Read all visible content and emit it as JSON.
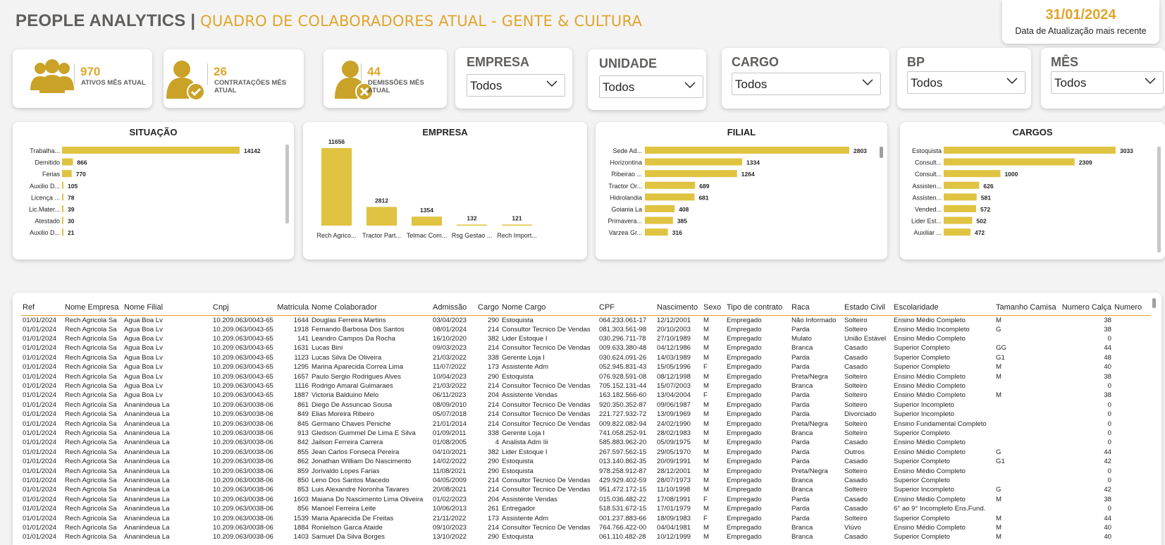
{
  "header": {
    "title_main": "PEOPLE ANALYTICS",
    "title_sep": "|",
    "title_sub": "QUADRO DE COLABORADORES ATUAL - GENTE & CULTURA"
  },
  "update": {
    "date": "31/01/2024",
    "label": "Data de Atualização mais recente"
  },
  "kpis": [
    {
      "value": "970",
      "label": "ATIVOS MÊS ATUAL",
      "icon": "group-icon"
    },
    {
      "value": "26",
      "label": "CONTRATAÇÕES MÊS ATUAL",
      "icon": "user-check-icon"
    },
    {
      "value": "44",
      "label": "DEMISSÕES MÊS ATUAL",
      "icon": "user-remove-icon"
    }
  ],
  "slicers": [
    {
      "title": "EMPRESA",
      "value": "Todos"
    },
    {
      "title": "UNIDADE",
      "value": "Todos"
    },
    {
      "title": "CARGO",
      "value": "Todos"
    },
    {
      "title": "BP",
      "value": "Todos"
    },
    {
      "title": "MÊS",
      "value": "Todos"
    }
  ],
  "colors": {
    "accent": "#e0a52a",
    "bar": "#e0c341",
    "title_gray": "#605e5c"
  },
  "chart_data": [
    {
      "type": "bar",
      "orientation": "horizontal",
      "title": "SITUAÇÃO",
      "categories": [
        "Trabalha...",
        "Demitido",
        "Ferias",
        "Auxilio D...",
        "Licença ...",
        "Lic.Mater...",
        "Atestado",
        "Auxilio D..."
      ],
      "values": [
        14142,
        866,
        770,
        105,
        78,
        39,
        30,
        21
      ]
    },
    {
      "type": "bar",
      "orientation": "vertical",
      "title": "EMPRESA",
      "categories": [
        "Rech Agrico...",
        "Tractor Part...",
        "Telmac Com...",
        "Rsg Gestao ...",
        "Rech Import..."
      ],
      "values": [
        11656,
        2812,
        1354,
        132,
        121
      ]
    },
    {
      "type": "bar",
      "orientation": "horizontal",
      "title": "FILIAL",
      "categories": [
        "Sede Ad...",
        "Horizontina",
        "Ribeirao ...",
        "Tractor Or...",
        "Hidrolandia",
        "Goiania La",
        "Primavera...",
        "Varzea Gr..."
      ],
      "values": [
        2803,
        1334,
        1264,
        689,
        681,
        408,
        385,
        316
      ]
    },
    {
      "type": "bar",
      "orientation": "horizontal",
      "title": "CARGOS",
      "categories": [
        "Estoquista",
        "Consult...",
        "Consult...",
        "Assisten...",
        "Assisten...",
        "Vended...",
        "Lider Est...",
        "Auxiliar ..."
      ],
      "values": [
        3033,
        2309,
        1000,
        626,
        581,
        572,
        502,
        472
      ]
    }
  ],
  "table": {
    "columns": [
      "Ref",
      "Nome Empresa",
      "Nome Filial",
      "Cnpj",
      "Matricula",
      "Nome Colaborador",
      "Admissão",
      "Cargo",
      "Nome Cargo",
      "CPF",
      "Nascimento",
      "Sexo",
      "Tipo de contrato",
      "Raca",
      "Estado Civil",
      "Escolaridade",
      "Tamanho Camisa",
      "Numero Calça",
      "Numero"
    ],
    "rows": [
      [
        "01/01/2024",
        "Rech Agricola Sa",
        "Agua Boa Lv",
        "10.209.063/0043-65",
        "1644",
        "Douglas Ferreira Martins",
        "03/04/2023",
        "290",
        "Estoquista",
        "064.233.061-17",
        "12/12/2001",
        "M",
        "Empregado",
        "Não Informado",
        "Solteiro",
        "Ensino Médio Completo",
        "M",
        "38",
        ""
      ],
      [
        "01/01/2024",
        "Rech Agricola Sa",
        "Agua Boa Lv",
        "10.209.063/0043-65",
        "1918",
        "Fernando Barbosa Dos Santos",
        "08/01/2024",
        "214",
        "Consultor Tecnico De Vendas",
        "081.303.561-98",
        "20/10/2003",
        "M",
        "Empregado",
        "Parda",
        "Solteiro",
        "Ensino Médio Incompleto",
        "G",
        "38",
        ""
      ],
      [
        "01/01/2024",
        "Rech Agricola Sa",
        "Agua Boa Lv",
        "10.209.063/0043-65",
        "141",
        "Leandro Campos Da Rocha",
        "16/10/2020",
        "382",
        "Lider Estoque I",
        "030.296.711-78",
        "27/10/1989",
        "M",
        "Empregado",
        "Mulato",
        "União Estável",
        "Ensino Médio Completo",
        "",
        "0",
        ""
      ],
      [
        "01/01/2024",
        "Rech Agricola Sa",
        "Agua Boa Lv",
        "10.209.063/0043-65",
        "1631",
        "Lucas Bini",
        "09/03/2023",
        "214",
        "Consultor Tecnico De Vendas",
        "009.633.380-48",
        "04/12/1986",
        "M",
        "Empregado",
        "Branca",
        "Casado",
        "Superior Completo",
        "GG",
        "44",
        ""
      ],
      [
        "01/01/2024",
        "Rech Agricola Sa",
        "Agua Boa Lv",
        "10.209.063/0043-65",
        "1123",
        "Lucas Silva De Oliveira",
        "21/03/2022",
        "338",
        "Gerente Loja I",
        "030.624.091-26",
        "14/03/1989",
        "M",
        "Empregado",
        "Parda",
        "Casado",
        "Superior Completo",
        "G1",
        "48",
        ""
      ],
      [
        "01/01/2024",
        "Rech Agricola Sa",
        "Agua Boa Lv",
        "10.209.063/0043-65",
        "1295",
        "Marina Aparecida Correa Lima",
        "11/07/2022",
        "173",
        "Assistente Adm",
        "052.945.831-43",
        "15/05/1996",
        "F",
        "Empregado",
        "Parda",
        "Casado",
        "Superior Completo",
        "M",
        "40",
        ""
      ],
      [
        "01/01/2024",
        "Rech Agricola Sa",
        "Agua Boa Lv",
        "10.209.063/0043-65",
        "1657",
        "Paulo Sergio Rodrigues Alves",
        "10/04/2023",
        "290",
        "Estoquista",
        "076.928.591-08",
        "08/12/1998",
        "M",
        "Empregado",
        "Preta/Negra",
        "Solteiro",
        "Ensino Médio Completo",
        "M",
        "38",
        ""
      ],
      [
        "01/01/2024",
        "Rech Agricola Sa",
        "Agua Boa Lv",
        "10.209.063/0043-65",
        "1116",
        "Rodrigo Amaral Guimaraes",
        "21/03/2022",
        "214",
        "Consultor Tecnico De Vendas",
        "705.152.131-44",
        "15/07/2003",
        "M",
        "Empregado",
        "Branca",
        "Solteiro",
        "Ensino Médio Completo",
        "",
        "0",
        ""
      ],
      [
        "01/01/2024",
        "Rech Agricola Sa",
        "Agua Boa Lv",
        "10.209.063/0043-65",
        "1887",
        "Victoria Balduino Melo",
        "06/11/2023",
        "204",
        "Assistente Vendas",
        "163.182.566-60",
        "13/04/2004",
        "F",
        "Empregado",
        "Parda",
        "Solteiro",
        "Ensino Médio Completo",
        "M",
        "38",
        ""
      ],
      [
        "01/01/2024",
        "Rech Agricola Sa",
        "Ananindeua La",
        "10.209.063/0038-06",
        "861",
        "Diego De Assuncao Sousa",
        "08/09/2010",
        "214",
        "Consultor Tecnico De Vendas",
        "920.350.352-87",
        "09/06/1987",
        "M",
        "Empregado",
        "Parda",
        "Solteiro",
        "Superior Incompleto",
        "",
        "0",
        ""
      ],
      [
        "01/01/2024",
        "Rech Agricola Sa",
        "Ananindeua La",
        "10.209.063/0038-06",
        "849",
        "Elias Moreira Ribeiro",
        "05/07/2018",
        "214",
        "Consultor Tecnico De Vendas",
        "221.727.932-72",
        "13/09/1969",
        "M",
        "Empregado",
        "Parda",
        "Divorciado",
        "Superior Incompleto",
        "",
        "0",
        ""
      ],
      [
        "01/01/2024",
        "Rech Agricola Sa",
        "Ananindeua La",
        "10.209.063/0038-06",
        "845",
        "Germano Chaves Peniche",
        "21/01/2014",
        "214",
        "Consultor Tecnico De Vendas",
        "009.822.082-94",
        "24/02/1990",
        "M",
        "Empregado",
        "Preta/Negra",
        "Solteiro",
        "Ensino Fundamental Completo",
        "",
        "0",
        ""
      ],
      [
        "01/01/2024",
        "Rech Agricola Sa",
        "Ananindeua La",
        "10.209.063/0038-06",
        "913",
        "Gledson Guimmel De Lima E Silva",
        "01/09/2011",
        "338",
        "Gerente Loja I",
        "741.058.252-91",
        "28/02/1983",
        "M",
        "Empregado",
        "Branca",
        "Solteiro",
        "Superior Completo",
        "",
        "0",
        ""
      ],
      [
        "01/01/2024",
        "Rech Agricola Sa",
        "Ananindeua La",
        "10.209.063/0038-06",
        "842",
        "Jailson Ferreira Carrera",
        "01/08/2005",
        "4",
        "Analista Adm Iii",
        "585.883.962-20",
        "05/09/1975",
        "M",
        "Empregado",
        "Parda",
        "Casado",
        "Ensino Médio Completo",
        "",
        "0",
        ""
      ],
      [
        "01/01/2024",
        "Rech Agricola Sa",
        "Ananindeua La",
        "10.209.063/0038-06",
        "855",
        "Jean Carlos Fonseca Pereira",
        "04/10/2021",
        "382",
        "Lider Estoque I",
        "267.597.562-15",
        "29/05/1970",
        "M",
        "Empregado",
        "Parda",
        "Outros",
        "Ensino Médio Completo",
        "G",
        "44",
        ""
      ],
      [
        "01/01/2024",
        "Rech Agricola Sa",
        "Ananindeua La",
        "10.209.063/0038-06",
        "862",
        "Jonathan William Do Nascimento",
        "14/02/2022",
        "290",
        "Estoquista",
        "013.140.862-35",
        "20/09/1991",
        "M",
        "Empregado",
        "Parda",
        "Casado",
        "Superior Completo",
        "G1",
        "42",
        ""
      ],
      [
        "01/01/2024",
        "Rech Agricola Sa",
        "Ananindeua La",
        "10.209.063/0038-06",
        "859",
        "Jorivaldo Lopes Farias",
        "11/08/2021",
        "290",
        "Estoquista",
        "978.258.912-87",
        "28/12/2001",
        "M",
        "Empregado",
        "Preta/Negra",
        "Solteiro",
        "Ensino Médio Completo",
        "",
        "0",
        ""
      ],
      [
        "01/01/2024",
        "Rech Agricola Sa",
        "Ananindeua La",
        "10.209.063/0038-06",
        "850",
        "Leno Dos Santos Macedo",
        "04/05/2009",
        "214",
        "Consultor Tecnico De Vendas",
        "429.929.402-59",
        "28/07/1973",
        "M",
        "Empregado",
        "Branca",
        "Casado",
        "Superior Completo",
        "",
        "0",
        ""
      ],
      [
        "01/01/2024",
        "Rech Agricola Sa",
        "Ananindeua La",
        "10.209.063/0038-06",
        "853",
        "Luis Alexandre Noronha Tavares",
        "20/08/2021",
        "214",
        "Consultor Tecnico De Vendas",
        "951.472.172-15",
        "11/10/1998",
        "M",
        "Empregado",
        "Branca",
        "Solteiro",
        "Superior Incompleto",
        "G",
        "42",
        ""
      ],
      [
        "01/01/2024",
        "Rech Agricola Sa",
        "Ananindeua La",
        "10.209.063/0038-06",
        "1603",
        "Maiana Do Nascimento Lima Oliveira",
        "01/02/2023",
        "204",
        "Assistente Vendas",
        "015.036.482-22",
        "17/08/1991",
        "F",
        "Empregado",
        "Parda",
        "Casado",
        "Ensino Médio Completo",
        "M",
        "38",
        ""
      ],
      [
        "01/01/2024",
        "Rech Agricola Sa",
        "Ananindeua La",
        "10.209.063/0038-06",
        "856",
        "Manoel Ferreira Leite",
        "10/06/2013",
        "261",
        "Entregador",
        "518.531.672-15",
        "17/01/1979",
        "M",
        "Empregado",
        "Parda",
        "Casado",
        "6° ao 9° Incompleto Ens.Fund.",
        "",
        "0",
        ""
      ],
      [
        "01/01/2024",
        "Rech Agricola Sa",
        "Ananindeua La",
        "10.209.063/0038-06",
        "1539",
        "Maria Aparecida De Freitas",
        "21/11/2022",
        "173",
        "Assistente Adm",
        "001.237.883-66",
        "18/09/1983",
        "F",
        "Empregado",
        "Parda",
        "Solteiro",
        "Superior Completo",
        "M",
        "44",
        ""
      ],
      [
        "01/01/2024",
        "Rech Agricola Sa",
        "Ananindeua La",
        "10.209.063/0038-06",
        "1884",
        "Ronielson Garca Ataide",
        "09/10/2023",
        "214",
        "Consultor Tecnico De Vendas",
        "764.766.422-00",
        "04/04/1981",
        "M",
        "Empregado",
        "Branca",
        "Viúvo",
        "Ensino Médio Completo",
        "M",
        "40",
        ""
      ],
      [
        "01/01/2024",
        "Rech Agricola Sa",
        "Ananindeua La",
        "10.209.063/0038-06",
        "1403",
        "Samuel Da Silva Borges",
        "13/10/2022",
        "290",
        "Estoquista",
        "061.110.482-28",
        "10/12/1999",
        "M",
        "Empregado",
        "Branca",
        "Casado",
        "Superior Completo",
        "M",
        "40",
        ""
      ]
    ]
  }
}
